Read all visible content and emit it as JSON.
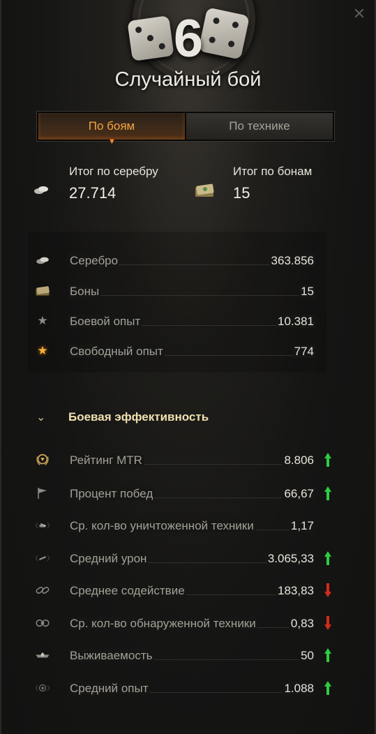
{
  "header": {
    "level": "6",
    "title": "Случайный бой"
  },
  "tabs": [
    {
      "label": "По боям",
      "active": true
    },
    {
      "label": "По технике",
      "active": false
    }
  ],
  "totals": {
    "silver": {
      "label": "Итог по серебру",
      "value": "27.714",
      "icon": "silver-icon"
    },
    "bonds": {
      "label": "Итог по бонам",
      "value": "15",
      "icon": "bonds-icon"
    }
  },
  "resources": [
    {
      "label": "Серебро",
      "value": "363.856",
      "icon": "silver-icon"
    },
    {
      "label": "Боны",
      "value": "15",
      "icon": "bonds-icon"
    },
    {
      "label": "Боевой опыт",
      "value": "10.381",
      "icon": "star-icon"
    },
    {
      "label": "Свободный опыт",
      "value": "774",
      "icon": "gold-star-icon"
    }
  ],
  "efficiency": {
    "title": "Боевая эффективность",
    "rows": [
      {
        "label": "Рейтинг MTR",
        "value": "8.806",
        "trend": "up",
        "icon": "rating-emblem-icon"
      },
      {
        "label": "Процент побед",
        "value": "66,67",
        "trend": "up",
        "icon": "flag-icon"
      },
      {
        "label": "Ср. кол-во уничтоженной техники",
        "value": "1,17",
        "trend": "none",
        "icon": "destroyed-tank-icon"
      },
      {
        "label": "Средний урон",
        "value": "3.065,33",
        "trend": "up",
        "icon": "damage-icon"
      },
      {
        "label": "Среднее содействие",
        "value": "183,83",
        "trend": "down",
        "icon": "assist-icon"
      },
      {
        "label": "Ср. кол-во обнаруженной техники",
        "value": "0,83",
        "trend": "down",
        "icon": "spotting-icon"
      },
      {
        "label": "Выживаемость",
        "value": "50",
        "trend": "up",
        "icon": "survival-icon"
      },
      {
        "label": "Средний опыт",
        "value": "1.088",
        "trend": "up",
        "icon": "experience-icon"
      }
    ]
  },
  "colors": {
    "up": "#2ecc40",
    "down": "#d22a1e",
    "accent": "#f3a340"
  }
}
